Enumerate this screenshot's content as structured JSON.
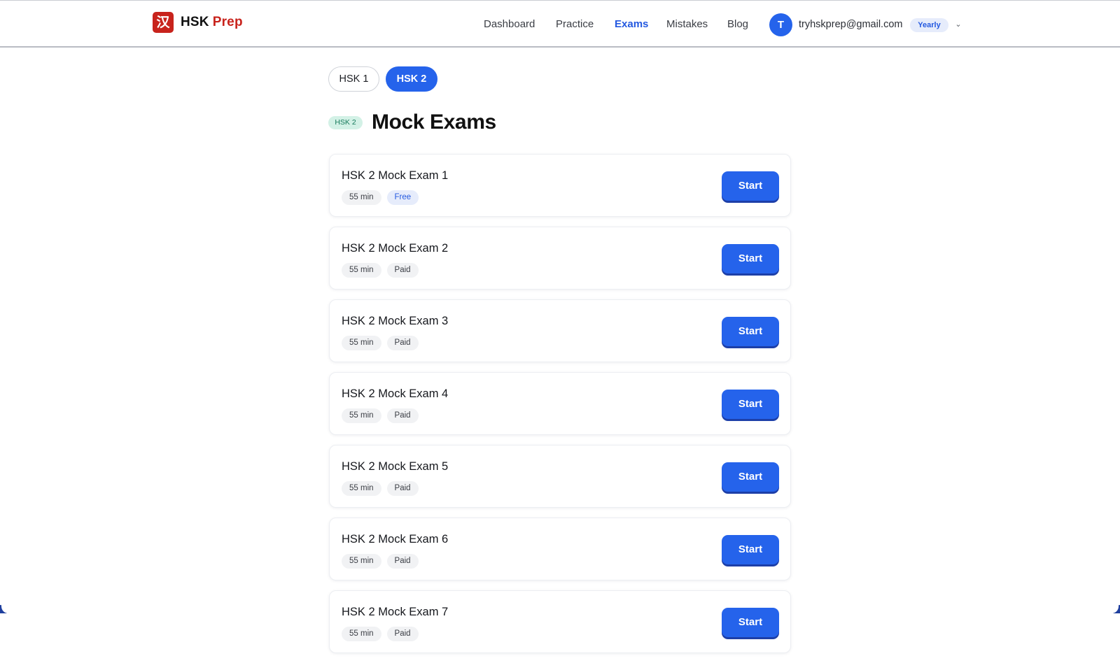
{
  "header": {
    "logo": {
      "mark": "汉",
      "name": "HSK",
      "accent": "Prep"
    },
    "nav": [
      {
        "label": "Dashboard",
        "active": false
      },
      {
        "label": "Practice",
        "active": false
      },
      {
        "label": "Exams",
        "active": true
      },
      {
        "label": "Mistakes",
        "active": false
      },
      {
        "label": "Blog",
        "active": false
      }
    ],
    "user": {
      "initial": "T",
      "email": "tryhskprep@gmail.com",
      "plan": "Yearly",
      "menu_icon": "chevron-down-icon"
    }
  },
  "level_tabs": [
    {
      "label": "HSK 1",
      "active": false
    },
    {
      "label": "HSK 2",
      "active": true
    }
  ],
  "page": {
    "level_chip": "HSK 2",
    "title": "Mock Exams"
  },
  "exams": [
    {
      "title": "HSK 2 Mock Exam 1",
      "duration": "55 min",
      "access": "Free",
      "action": "Start"
    },
    {
      "title": "HSK 2 Mock Exam 2",
      "duration": "55 min",
      "access": "Paid",
      "action": "Start"
    },
    {
      "title": "HSK 2 Mock Exam 3",
      "duration": "55 min",
      "access": "Paid",
      "action": "Start"
    },
    {
      "title": "HSK 2 Mock Exam 4",
      "duration": "55 min",
      "access": "Paid",
      "action": "Start"
    },
    {
      "title": "HSK 2 Mock Exam 5",
      "duration": "55 min",
      "access": "Paid",
      "action": "Start"
    },
    {
      "title": "HSK 2 Mock Exam 6",
      "duration": "55 min",
      "access": "Paid",
      "action": "Start"
    },
    {
      "title": "HSK 2 Mock Exam 7",
      "duration": "55 min",
      "access": "Paid",
      "action": "Start"
    }
  ],
  "colors": {
    "primary": "#2563eb",
    "brand_red": "#c8231c",
    "free_badge": "#e6ecfb",
    "level_chip": "#d3f1e6"
  }
}
